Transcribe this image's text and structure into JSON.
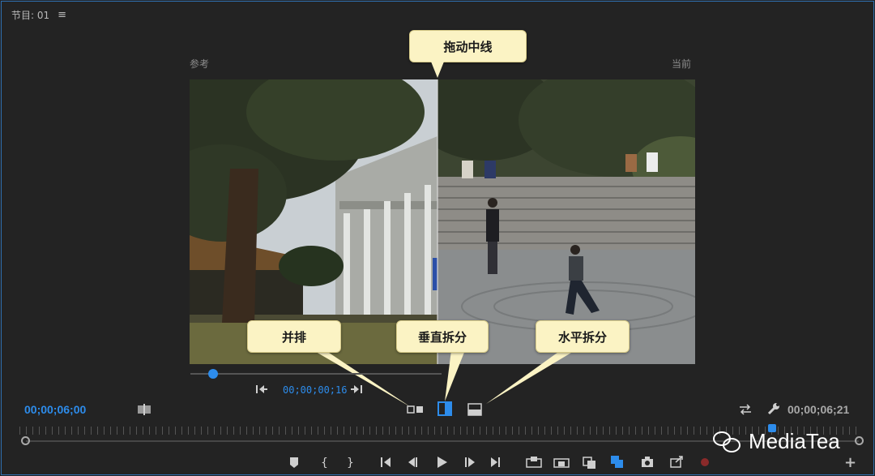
{
  "panel": {
    "title": "节目: 01",
    "menu_icon": "≡"
  },
  "monitor": {
    "left_label": "参考",
    "right_label": "当前"
  },
  "callouts": {
    "drag_center": "拖动中线",
    "side_by_side": "并排",
    "vertical_split": "垂直拆分",
    "horizontal_split": "水平拆分"
  },
  "reference": {
    "timecode": "00;00;00;16",
    "playhead_position": 0.09
  },
  "playback": {
    "current_timecode": "00;00;06;00",
    "duration_timecode": "00;00;06;21"
  },
  "watermark": {
    "text": "MediaTea"
  },
  "colors": {
    "accent": "#2d8ceb",
    "callout_bg": "#fbf3c4",
    "panel_bg": "#232323",
    "border": "#2f6fb0"
  },
  "icons": {
    "menu": "hamburger-icon",
    "compare": "compare-icon",
    "step_back": "step-back-to-start-icon",
    "step_forward": "step-forward-to-end-icon",
    "side_by_side": "side-by-side-icon",
    "vertical_split": "vertical-split-icon",
    "horizontal_split": "horizontal-split-icon",
    "swap": "swap-icon",
    "settings": "wrench-icon",
    "add": "plus-icon"
  }
}
